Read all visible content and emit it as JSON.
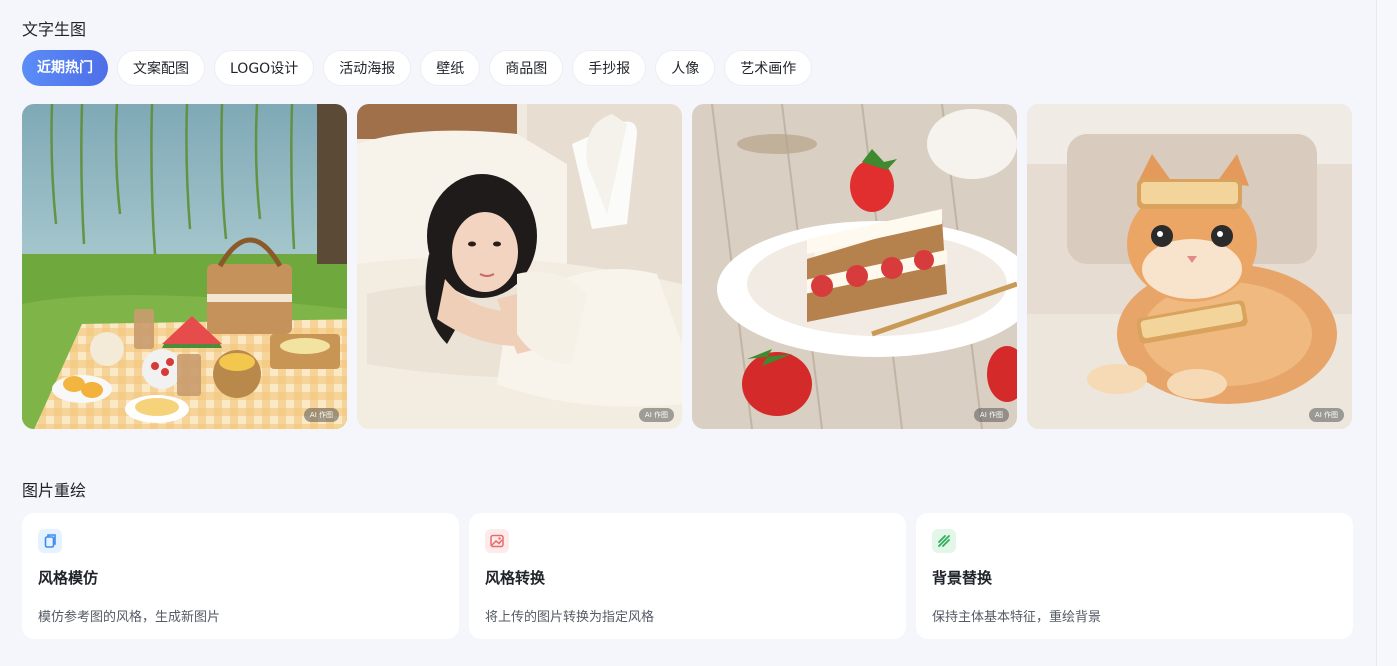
{
  "text_to_image": {
    "title": "文字生图",
    "tabs": [
      {
        "label": "近期热门",
        "active": true
      },
      {
        "label": "文案配图",
        "active": false
      },
      {
        "label": "LOGO设计",
        "active": false
      },
      {
        "label": "活动海报",
        "active": false
      },
      {
        "label": "壁纸",
        "active": false
      },
      {
        "label": "商品图",
        "active": false
      },
      {
        "label": "手抄报",
        "active": false
      },
      {
        "label": "人像",
        "active": false
      },
      {
        "label": "艺术画作",
        "active": false
      }
    ],
    "gallery": [
      {
        "subject": "picnic-by-lake",
        "badge": "AI 作图"
      },
      {
        "subject": "girl-on-bed",
        "badge": "AI 作图"
      },
      {
        "subject": "strawberry-cake",
        "badge": "AI 作图"
      },
      {
        "subject": "cat-with-toast",
        "badge": "AI 作图"
      }
    ]
  },
  "image_redraw": {
    "title": "图片重绘",
    "features": [
      {
        "title": "风格模仿",
        "desc": "模仿参考图的风格，生成新图片",
        "icon": "style-imitate-icon",
        "icon_bg": "#e6f2ff",
        "icon_color": "#3d8bf2"
      },
      {
        "title": "风格转换",
        "desc": "将上传的图片转换为指定风格",
        "icon": "style-convert-icon",
        "icon_bg": "#fdeaea",
        "icon_color": "#e86a6a"
      },
      {
        "title": "背景替换",
        "desc": "保持主体基本特征，重绘背景",
        "icon": "background-replace-icon",
        "icon_bg": "#e3f6e8",
        "icon_color": "#2fae5b"
      }
    ]
  },
  "colors": {
    "accent_start": "#5b8df7",
    "accent_end": "#4e6ee8",
    "page_bg": "#f5f6fb"
  }
}
